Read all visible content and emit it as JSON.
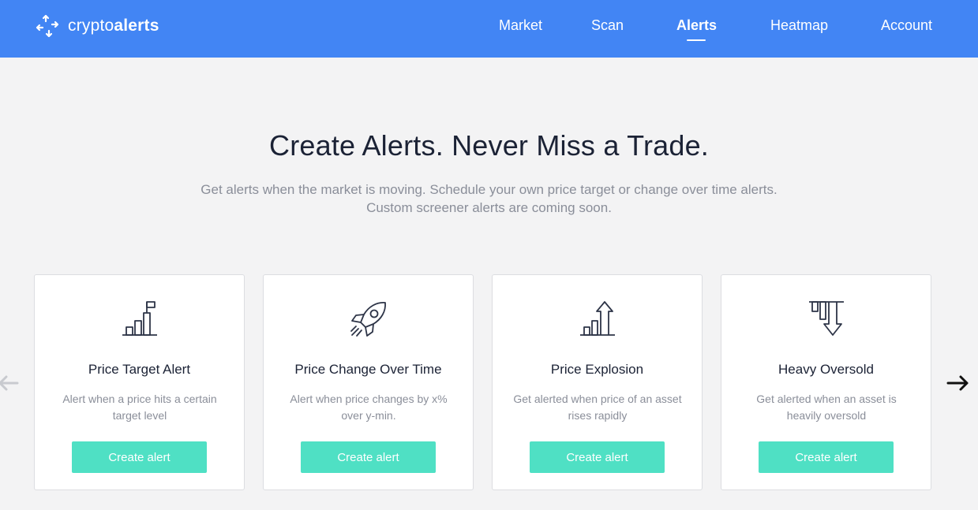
{
  "brand": {
    "name_light": "crypto",
    "name_bold": "alerts"
  },
  "nav": {
    "items": [
      {
        "label": "Market",
        "active": false
      },
      {
        "label": "Scan",
        "active": false
      },
      {
        "label": "Alerts",
        "active": true
      },
      {
        "label": "Heatmap",
        "active": false
      },
      {
        "label": "Account",
        "active": false
      }
    ]
  },
  "hero": {
    "title": "Create Alerts. Never Miss a Trade.",
    "subtitle_line1": "Get alerts when the market is moving. Schedule your own price target or change over time alerts.",
    "subtitle_line2": "Custom screener alerts are coming soon."
  },
  "cards": [
    {
      "icon": "bar-chart-flag-icon",
      "title": "Price Target Alert",
      "desc": "Alert when a price hits a certain target level",
      "button": "Create alert"
    },
    {
      "icon": "rocket-icon",
      "title": "Price Change Over Time",
      "desc": "Alert when price changes by x% over y-min.",
      "button": "Create alert"
    },
    {
      "icon": "bar-chart-up-arrow-icon",
      "title": "Price Explosion",
      "desc": "Get alerted when price of an asset rises rapidly",
      "button": "Create alert"
    },
    {
      "icon": "bar-down-arrow-icon",
      "title": "Heavy Oversold",
      "desc": "Get alerted when an asset is heavily oversold",
      "button": "Create alert"
    }
  ],
  "colors": {
    "nav_bg": "#4285f4",
    "button_bg": "#4fe0c4",
    "page_bg": "#f3f3f4"
  }
}
